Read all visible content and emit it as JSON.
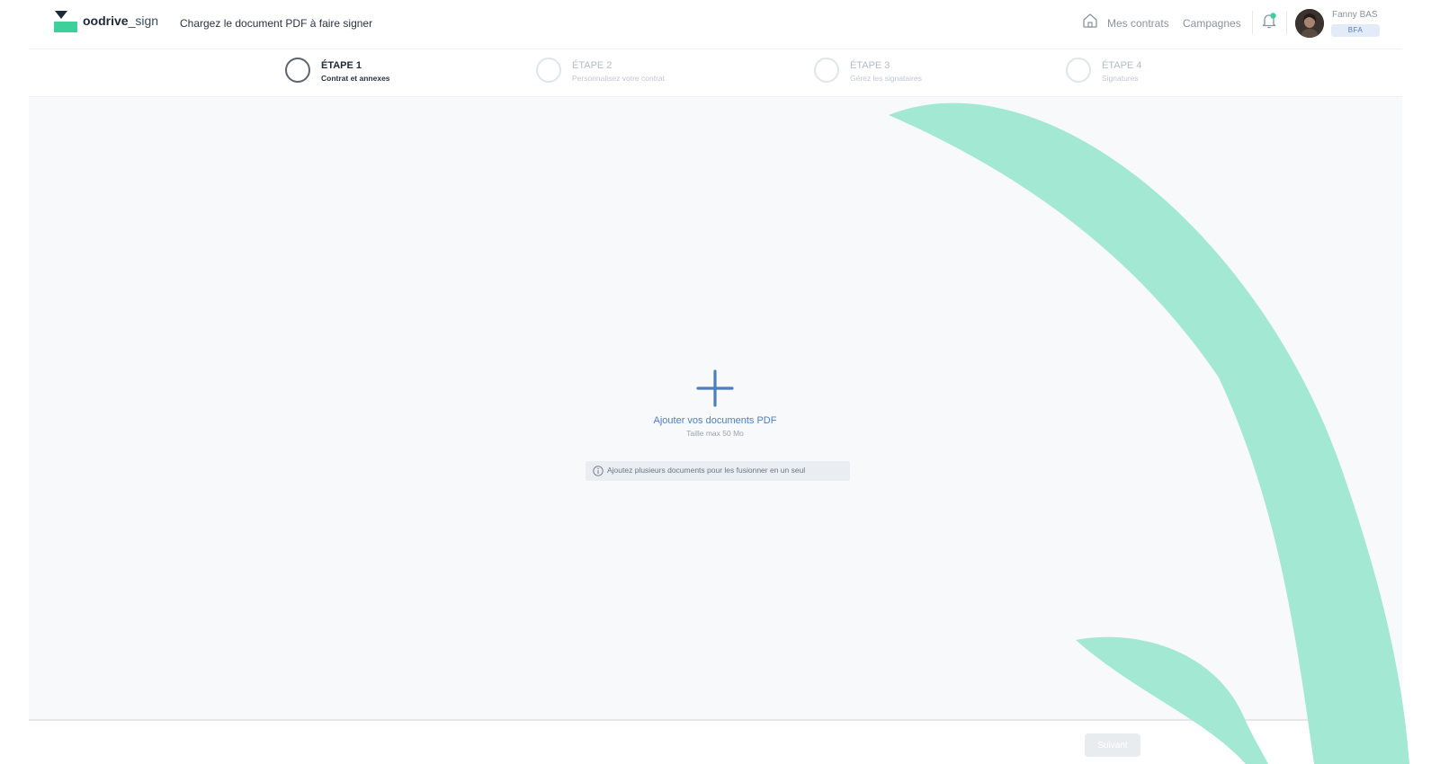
{
  "header": {
    "brand_bold": "oodrive",
    "brand_rest": "_sign",
    "page_title": "Chargez le document PDF à faire signer",
    "nav": {
      "contracts": "Mes contrats",
      "campaigns": "Campagnes"
    },
    "user": {
      "name": "Fanny BAS",
      "badge": "BFA"
    }
  },
  "steps": [
    {
      "label": "ÉTAPE 1",
      "subtitle": "Contrat et annexes",
      "active": true
    },
    {
      "label": "ÉTAPE 2",
      "subtitle": "Personnalisez votre contrat",
      "active": false
    },
    {
      "label": "ÉTAPE 3",
      "subtitle": "Gérez les signataires",
      "active": false
    },
    {
      "label": "ÉTAPE 4",
      "subtitle": "Signatures",
      "active": false
    }
  ],
  "upload": {
    "title": "Ajouter vos documents PDF",
    "subtitle": "Taille max 50 Mo",
    "hint": "Ajoutez plusieurs documents pour les fusionner en un seul"
  },
  "footer": {
    "next_label": "Suivant"
  },
  "colors": {
    "accent_blue": "#4e7ec0",
    "brand_green": "#3ecf9a",
    "swoosh_green": "#a3e8d2",
    "background": "#f8f9fa"
  }
}
